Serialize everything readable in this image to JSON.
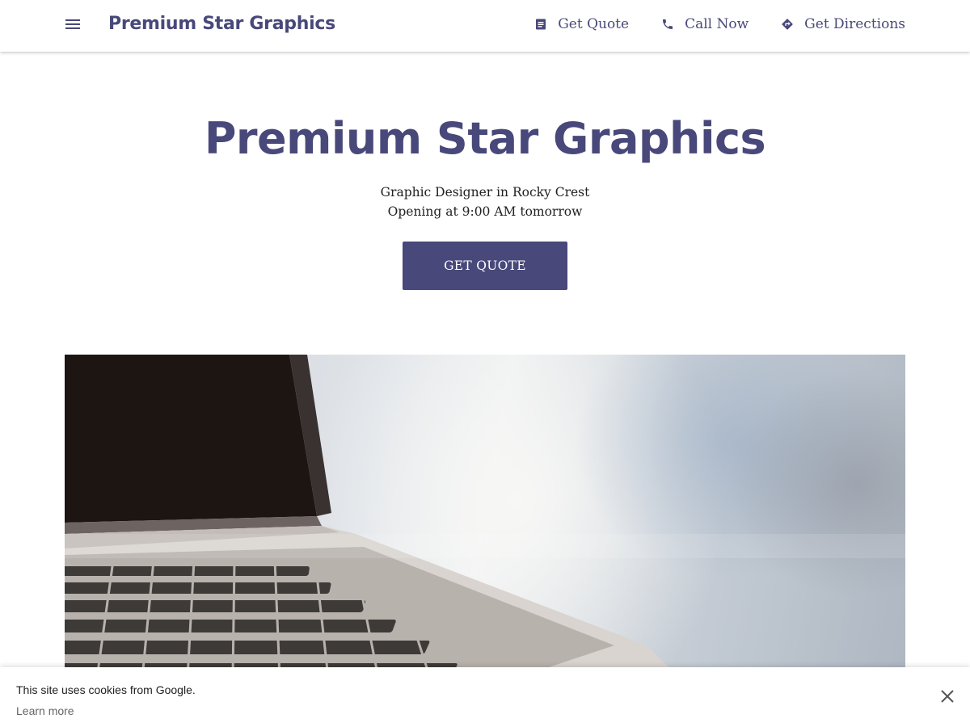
{
  "header": {
    "menu_icon": "menu-icon",
    "brand": "Premium Star Graphics",
    "nav": [
      {
        "label": "Get Quote",
        "icon": "document-icon"
      },
      {
        "label": "Call Now",
        "icon": "phone-icon"
      },
      {
        "label": "Get Directions",
        "icon": "directions-icon"
      }
    ]
  },
  "hero": {
    "title": "Premium Star Graphics",
    "subtitle": "Graphic Designer in Rocky Crest",
    "status": "Opening at 9:00 AM tomorrow",
    "cta_label": "GET QUOTE",
    "image": "laptop-keyboard-photo"
  },
  "cookie_bar": {
    "text": "This site uses cookies from Google.",
    "link": "Learn more",
    "close_icon": "close-icon"
  },
  "colors": {
    "primary": "#48487a",
    "text": "#212121",
    "background": "#ffffff"
  }
}
